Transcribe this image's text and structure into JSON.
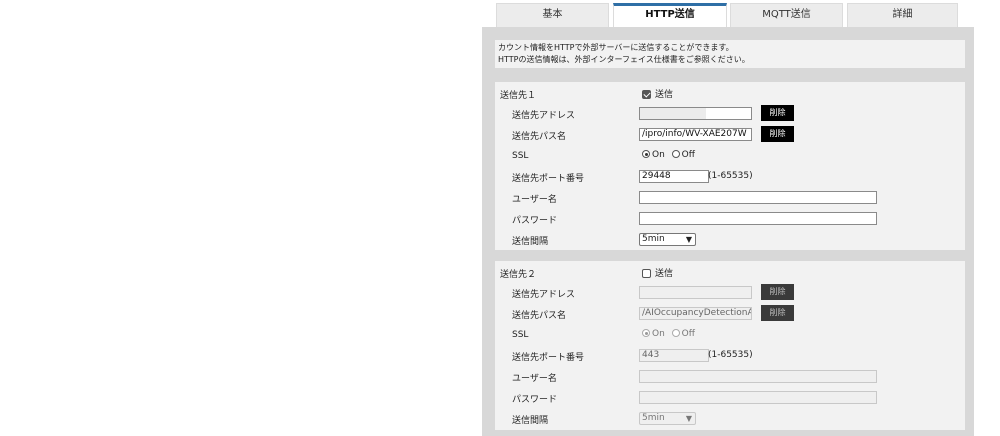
{
  "tabs": [
    {
      "label": "基本",
      "active": false
    },
    {
      "label": "HTTP送信",
      "active": true
    },
    {
      "label": "MQTT送信",
      "active": false
    },
    {
      "label": "詳細",
      "active": false
    }
  ],
  "description": {
    "line1": "カウント情報をHTTPで外部サーバーに送信することができます。",
    "line2": "HTTPの送信情報は、外部インターフェイス仕様書をご参照ください。"
  },
  "destinations": [
    {
      "title": "送信先１",
      "enable_label": "送信",
      "enabled": true,
      "address_label": "送信先アドレス",
      "address_value": "",
      "path_label": "送信先パス名",
      "path_value": "/ipro/info/WV-XAE207W",
      "delete_label": "削除",
      "ssl_label": "SSL",
      "ssl_on": "On",
      "ssl_off": "Off",
      "port_label": "送信先ポート番号",
      "port_value": "29448",
      "port_range": "(1-65535)",
      "user_label": "ユーザー名",
      "user_value": "",
      "password_label": "パスワード",
      "password_value": "",
      "interval_label": "送信間隔",
      "interval_value": "5min"
    },
    {
      "title": "送信先２",
      "enable_label": "送信",
      "enabled": false,
      "address_label": "送信先アドレス",
      "address_value": "",
      "path_label": "送信先パス名",
      "path_value": "/AIOccupancyDetectionAp",
      "delete_label": "削除",
      "ssl_label": "SSL",
      "ssl_on": "On",
      "ssl_off": "Off",
      "port_label": "送信先ポート番号",
      "port_value": "443",
      "port_range": "(1-65535)",
      "user_label": "ユーザー名",
      "user_value": "",
      "password_label": "パスワード",
      "password_value": "",
      "interval_label": "送信間隔",
      "interval_value": "5min"
    }
  ],
  "colors": {
    "active_tab_accent": "#2f6fa6",
    "panel_background": "#d8d8d8",
    "section_background": "#f2f2f2",
    "button_background": "#000000"
  }
}
